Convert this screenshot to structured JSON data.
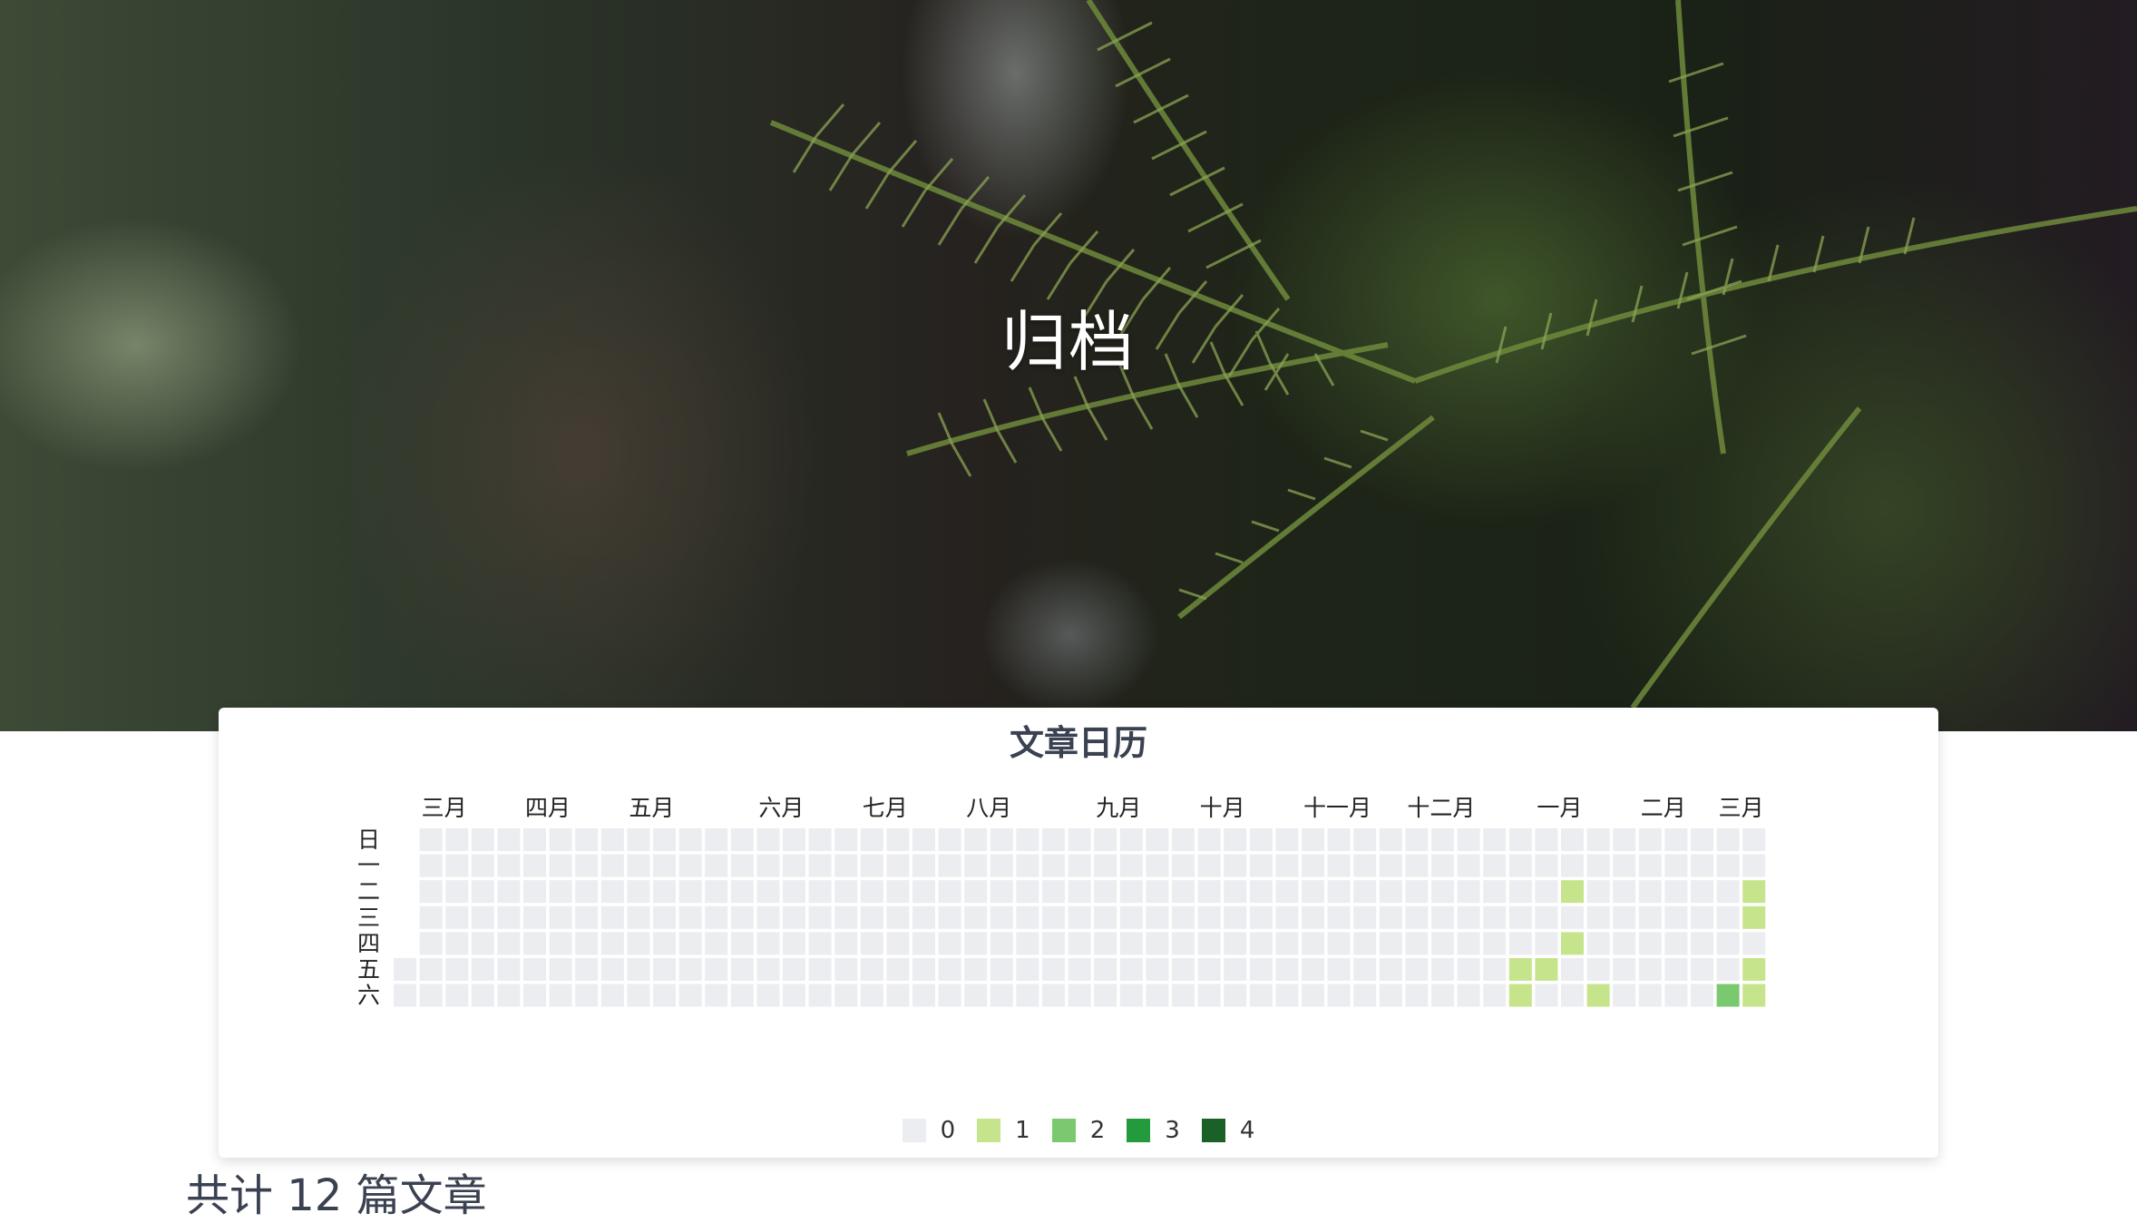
{
  "page": {
    "title": "归档",
    "total_text": "共计 12 篇文章"
  },
  "calendar": {
    "title": "文章日历",
    "months": [
      {
        "label": "三月",
        "week": 1
      },
      {
        "label": "四月",
        "week": 5
      },
      {
        "label": "五月",
        "week": 9
      },
      {
        "label": "六月",
        "week": 14
      },
      {
        "label": "七月",
        "week": 18
      },
      {
        "label": "八月",
        "week": 22
      },
      {
        "label": "九月",
        "week": 27
      },
      {
        "label": "十月",
        "week": 31
      },
      {
        "label": "十一月",
        "week": 35
      },
      {
        "label": "十二月",
        "week": 39
      },
      {
        "label": "一月",
        "week": 44
      },
      {
        "label": "二月",
        "week": 48
      },
      {
        "label": "三月",
        "week": 51
      }
    ],
    "weekdays": [
      "日",
      "一",
      "二",
      "三",
      "四",
      "五",
      "六"
    ],
    "week_count": 53,
    "first_week_start_day": 5,
    "last_week_end_day": 6,
    "colors": [
      "#ebedf0",
      "#c6e48b",
      "#7bc96f",
      "#239a3b",
      "#196127"
    ],
    "active_days": [
      {
        "week": 43,
        "day": 5,
        "count": 1
      },
      {
        "week": 43,
        "day": 6,
        "count": 1
      },
      {
        "week": 44,
        "day": 5,
        "count": 1
      },
      {
        "week": 45,
        "day": 2,
        "count": 1
      },
      {
        "week": 45,
        "day": 4,
        "count": 1
      },
      {
        "week": 46,
        "day": 6,
        "count": 1
      },
      {
        "week": 51,
        "day": 6,
        "count": 2
      },
      {
        "week": 52,
        "day": 2,
        "count": 1
      },
      {
        "week": 52,
        "day": 3,
        "count": 1
      },
      {
        "week": 52,
        "day": 5,
        "count": 1
      },
      {
        "week": 52,
        "day": 6,
        "count": 1
      }
    ],
    "legend": [
      {
        "label": "0",
        "color": "#ebedf0"
      },
      {
        "label": "1",
        "color": "#c6e48b"
      },
      {
        "label": "2",
        "color": "#7bc96f"
      },
      {
        "label": "3",
        "color": "#239a3b"
      },
      {
        "label": "4",
        "color": "#196127"
      }
    ]
  }
}
